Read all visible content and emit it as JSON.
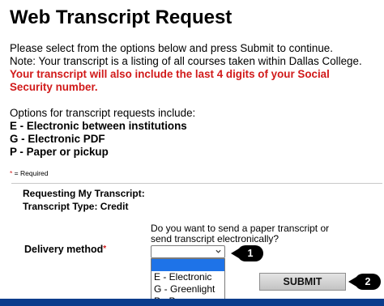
{
  "page": {
    "title": "Web Transcript Request",
    "instructions": "Please select from the options below and press Submit to continue.",
    "note": "Note: Your transcript is a listing of all courses taken within Dallas College.",
    "warning_line1": "Your transcript will also include the last 4 digits of your Social",
    "warning_line2": "Security number.",
    "options_intro": "Options for transcript requests include:",
    "options": [
      "E - Electronic between institutions",
      "G - Electronic PDF",
      "P - Paper or pickup"
    ],
    "required_note_star": "*",
    "required_note_text": " = Required"
  },
  "form": {
    "requesting_heading": "Requesting My Transcript:",
    "transcript_type": "Transcript Type: Credit",
    "question_line1": "Do you want to send a paper transcript or",
    "question_line2": "send transcript electronically?",
    "delivery_label": "Delivery method",
    "required_star": "*",
    "delivery_selected_value": "",
    "delivery_options": [
      "",
      "E - Electronic",
      "G - Greenlight",
      "P - Paper"
    ],
    "submit_label": "SUBMIT"
  },
  "callouts": {
    "dropdown_marker": "1",
    "submit_marker": "2"
  },
  "colors": {
    "required_red": "#d11a1a",
    "selection_blue": "#1e73e8",
    "footer_navy": "#0b3c8c"
  }
}
